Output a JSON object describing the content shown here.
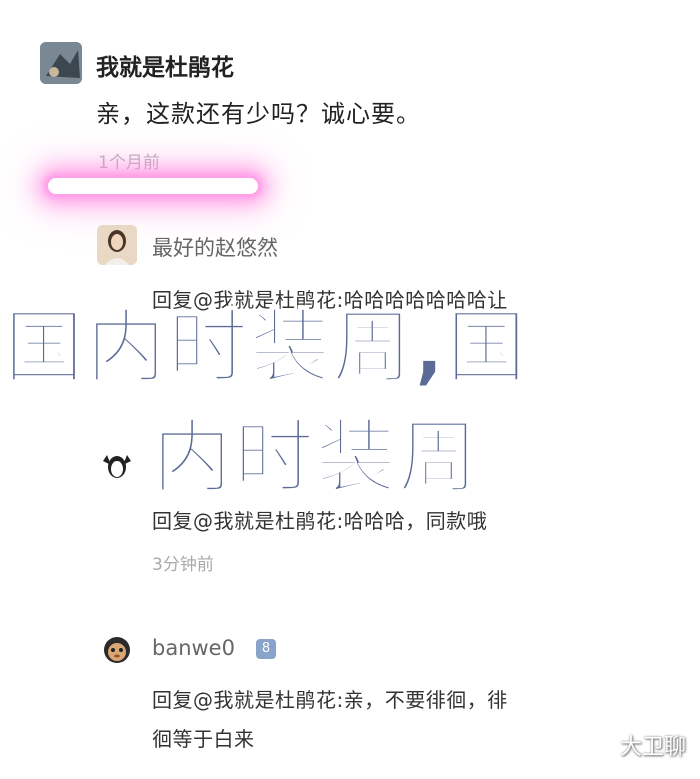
{
  "top_partial_text": "",
  "main_comment": {
    "username": "我就是杜鹃花",
    "text": "亲，这款还有少吗？诚心要。",
    "time": "1个月前"
  },
  "replies": [
    {
      "username": "最好的赵悠然",
      "text_line1": "回复@我就是杜鹃花:哈哈哈哈哈哈哈让",
      "text_line2": "",
      "time": ""
    },
    {
      "username": "",
      "text_line1": "回复@我就是杜鹃花:哈哈哈，同款哦",
      "time": "3分钟前"
    },
    {
      "username": "banwe0",
      "badge": "8",
      "text_line1": "回复@我就是杜鹃花:亲，不要徘徊，徘",
      "text_line2": "徊等于白来",
      "time": ""
    }
  ],
  "overlay_title_line1": "国内时装周,国",
  "overlay_title_line2": "内时装周",
  "watermark": "大卫聊",
  "colors": {
    "overlay": "#5b6b96",
    "neon": "#ff9ee8"
  }
}
